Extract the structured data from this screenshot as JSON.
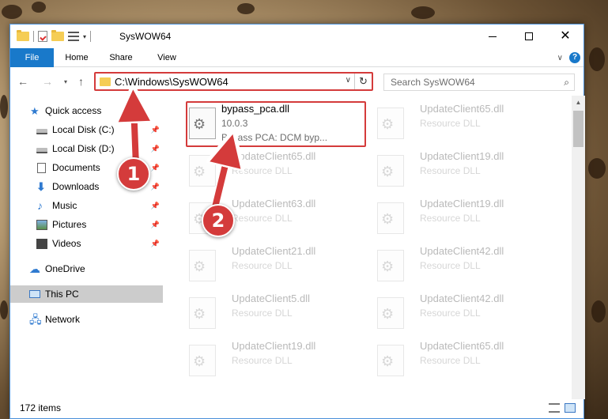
{
  "window": {
    "title": "SysWOW64",
    "controls": {
      "minimize": "minimize-icon",
      "maximize": "maximize-icon",
      "close": "close-icon"
    }
  },
  "ribbon": {
    "tabs": [
      "File",
      "Home",
      "Share",
      "View"
    ],
    "accent": "#1979ca"
  },
  "nav": {
    "address": "C:\\Windows\\SysWOW64",
    "search_placeholder": "Search SysWOW64"
  },
  "sidebar": {
    "items": [
      {
        "label": "Quick access",
        "icon": "star-icon",
        "pinned": false
      },
      {
        "label": "Local Disk (C:)",
        "icon": "disk-icon",
        "pinned": true
      },
      {
        "label": "Local Disk (D:)",
        "icon": "disk-icon",
        "pinned": true
      },
      {
        "label": "Documents",
        "icon": "documents-icon",
        "pinned": true
      },
      {
        "label": "Downloads",
        "icon": "downloads-icon",
        "pinned": true
      },
      {
        "label": "Music",
        "icon": "music-icon",
        "pinned": true
      },
      {
        "label": "Pictures",
        "icon": "pictures-icon",
        "pinned": true
      },
      {
        "label": "Videos",
        "icon": "videos-icon",
        "pinned": true
      },
      {
        "label": "OneDrive",
        "icon": "onedrive-icon",
        "pinned": false
      },
      {
        "label": "This PC",
        "icon": "this-pc-icon",
        "pinned": false,
        "selected": true
      },
      {
        "label": "Network",
        "icon": "network-icon",
        "pinned": false
      }
    ]
  },
  "files": {
    "highlighted": {
      "name": "bypass_pca.dll",
      "version": "10.0.3",
      "description": "Bypass PCA: DCM byp..."
    },
    "faded_left": [
      {
        "name": "UpdateClient65.dll",
        "type": "Resource DLL"
      },
      {
        "name": "UpdateClient63.dll",
        "type": "Resource DLL"
      },
      {
        "name": "UpdateClient21.dll",
        "type": "Resource DLL"
      },
      {
        "name": "UpdateClient5.dll",
        "type": "Resource DLL"
      },
      {
        "name": "UpdateClient19.dll",
        "type": "Resource DLL"
      }
    ],
    "faded_right": [
      {
        "name": "UpdateClient65.dll",
        "type": "Resource DLL"
      },
      {
        "name": "UpdateClient19.dll",
        "type": "Resource DLL"
      },
      {
        "name": "UpdateClient19.dll",
        "type": "Resource DLL"
      },
      {
        "name": "UpdateClient42.dll",
        "type": "Resource DLL"
      },
      {
        "name": "UpdateClient42.dll",
        "type": "Resource DLL"
      },
      {
        "name": "UpdateClient65.dll",
        "type": "Resource DLL"
      }
    ]
  },
  "status": {
    "item_count": "172 items"
  },
  "callouts": {
    "step1": "1",
    "step2": "2",
    "color": "#d43b3b"
  }
}
